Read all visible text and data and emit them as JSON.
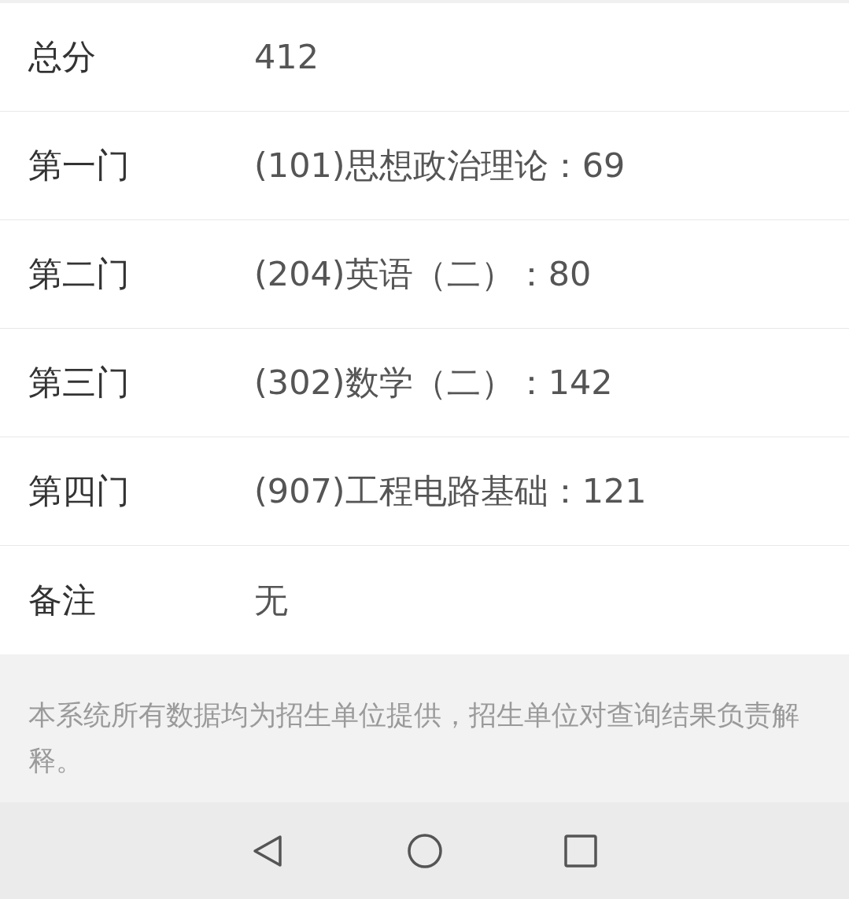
{
  "rows": [
    {
      "label": "总分",
      "value": "412"
    },
    {
      "label": "第一门",
      "value": "(101)思想政治理论：69"
    },
    {
      "label": "第二门",
      "value": "(204)英语（二）：80"
    },
    {
      "label": "第三门",
      "value": "(302)数学（二）：142"
    },
    {
      "label": "第四门",
      "value": "(907)工程电路基础：121"
    },
    {
      "label": "备注",
      "value": "无"
    }
  ],
  "footer_note": "本系统所有数据均为招生单位提供，招生单位对查询结果负责解释。",
  "nav_bar": {
    "buttons": [
      {
        "kind": "back"
      },
      {
        "kind": "home"
      },
      {
        "kind": "recents"
      }
    ]
  }
}
